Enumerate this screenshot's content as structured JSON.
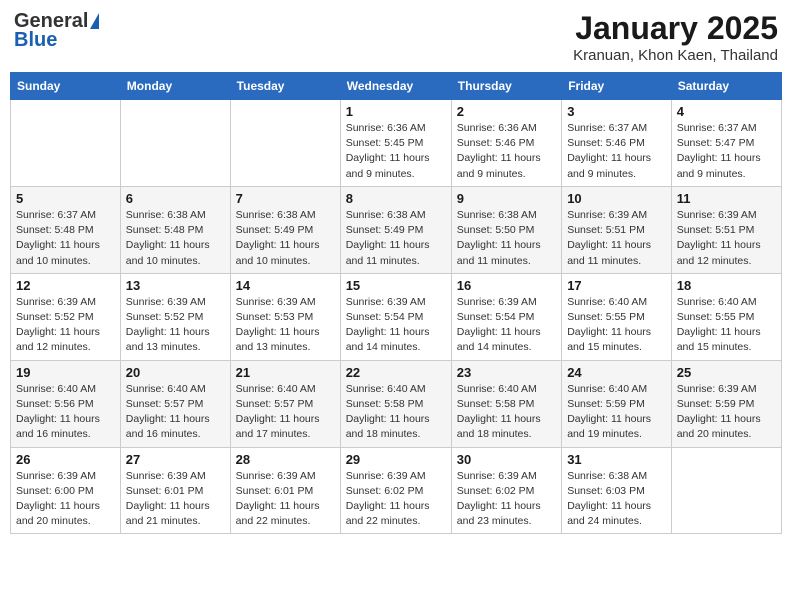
{
  "logo": {
    "general": "General",
    "blue": "Blue"
  },
  "title": "January 2025",
  "location": "Kranuan, Khon Kaen, Thailand",
  "days_of_week": [
    "Sunday",
    "Monday",
    "Tuesday",
    "Wednesday",
    "Thursday",
    "Friday",
    "Saturday"
  ],
  "weeks": [
    [
      {
        "day": "",
        "info": ""
      },
      {
        "day": "",
        "info": ""
      },
      {
        "day": "",
        "info": ""
      },
      {
        "day": "1",
        "info": "Sunrise: 6:36 AM\nSunset: 5:45 PM\nDaylight: 11 hours and 9 minutes."
      },
      {
        "day": "2",
        "info": "Sunrise: 6:36 AM\nSunset: 5:46 PM\nDaylight: 11 hours and 9 minutes."
      },
      {
        "day": "3",
        "info": "Sunrise: 6:37 AM\nSunset: 5:46 PM\nDaylight: 11 hours and 9 minutes."
      },
      {
        "day": "4",
        "info": "Sunrise: 6:37 AM\nSunset: 5:47 PM\nDaylight: 11 hours and 9 minutes."
      }
    ],
    [
      {
        "day": "5",
        "info": "Sunrise: 6:37 AM\nSunset: 5:48 PM\nDaylight: 11 hours and 10 minutes."
      },
      {
        "day": "6",
        "info": "Sunrise: 6:38 AM\nSunset: 5:48 PM\nDaylight: 11 hours and 10 minutes."
      },
      {
        "day": "7",
        "info": "Sunrise: 6:38 AM\nSunset: 5:49 PM\nDaylight: 11 hours and 10 minutes."
      },
      {
        "day": "8",
        "info": "Sunrise: 6:38 AM\nSunset: 5:49 PM\nDaylight: 11 hours and 11 minutes."
      },
      {
        "day": "9",
        "info": "Sunrise: 6:38 AM\nSunset: 5:50 PM\nDaylight: 11 hours and 11 minutes."
      },
      {
        "day": "10",
        "info": "Sunrise: 6:39 AM\nSunset: 5:51 PM\nDaylight: 11 hours and 11 minutes."
      },
      {
        "day": "11",
        "info": "Sunrise: 6:39 AM\nSunset: 5:51 PM\nDaylight: 11 hours and 12 minutes."
      }
    ],
    [
      {
        "day": "12",
        "info": "Sunrise: 6:39 AM\nSunset: 5:52 PM\nDaylight: 11 hours and 12 minutes."
      },
      {
        "day": "13",
        "info": "Sunrise: 6:39 AM\nSunset: 5:52 PM\nDaylight: 11 hours and 13 minutes."
      },
      {
        "day": "14",
        "info": "Sunrise: 6:39 AM\nSunset: 5:53 PM\nDaylight: 11 hours and 13 minutes."
      },
      {
        "day": "15",
        "info": "Sunrise: 6:39 AM\nSunset: 5:54 PM\nDaylight: 11 hours and 14 minutes."
      },
      {
        "day": "16",
        "info": "Sunrise: 6:39 AM\nSunset: 5:54 PM\nDaylight: 11 hours and 14 minutes."
      },
      {
        "day": "17",
        "info": "Sunrise: 6:40 AM\nSunset: 5:55 PM\nDaylight: 11 hours and 15 minutes."
      },
      {
        "day": "18",
        "info": "Sunrise: 6:40 AM\nSunset: 5:55 PM\nDaylight: 11 hours and 15 minutes."
      }
    ],
    [
      {
        "day": "19",
        "info": "Sunrise: 6:40 AM\nSunset: 5:56 PM\nDaylight: 11 hours and 16 minutes."
      },
      {
        "day": "20",
        "info": "Sunrise: 6:40 AM\nSunset: 5:57 PM\nDaylight: 11 hours and 16 minutes."
      },
      {
        "day": "21",
        "info": "Sunrise: 6:40 AM\nSunset: 5:57 PM\nDaylight: 11 hours and 17 minutes."
      },
      {
        "day": "22",
        "info": "Sunrise: 6:40 AM\nSunset: 5:58 PM\nDaylight: 11 hours and 18 minutes."
      },
      {
        "day": "23",
        "info": "Sunrise: 6:40 AM\nSunset: 5:58 PM\nDaylight: 11 hours and 18 minutes."
      },
      {
        "day": "24",
        "info": "Sunrise: 6:40 AM\nSunset: 5:59 PM\nDaylight: 11 hours and 19 minutes."
      },
      {
        "day": "25",
        "info": "Sunrise: 6:39 AM\nSunset: 5:59 PM\nDaylight: 11 hours and 20 minutes."
      }
    ],
    [
      {
        "day": "26",
        "info": "Sunrise: 6:39 AM\nSunset: 6:00 PM\nDaylight: 11 hours and 20 minutes."
      },
      {
        "day": "27",
        "info": "Sunrise: 6:39 AM\nSunset: 6:01 PM\nDaylight: 11 hours and 21 minutes."
      },
      {
        "day": "28",
        "info": "Sunrise: 6:39 AM\nSunset: 6:01 PM\nDaylight: 11 hours and 22 minutes."
      },
      {
        "day": "29",
        "info": "Sunrise: 6:39 AM\nSunset: 6:02 PM\nDaylight: 11 hours and 22 minutes."
      },
      {
        "day": "30",
        "info": "Sunrise: 6:39 AM\nSunset: 6:02 PM\nDaylight: 11 hours and 23 minutes."
      },
      {
        "day": "31",
        "info": "Sunrise: 6:38 AM\nSunset: 6:03 PM\nDaylight: 11 hours and 24 minutes."
      },
      {
        "day": "",
        "info": ""
      }
    ]
  ]
}
